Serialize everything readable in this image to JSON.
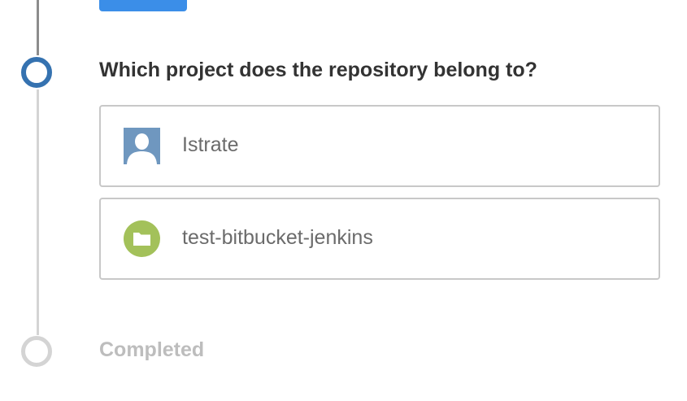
{
  "wizard": {
    "question": "Which project does the repository belong to?",
    "options": [
      {
        "label": "Istrate",
        "icon": "user-avatar-icon"
      },
      {
        "label": "test-bitbucket-jenkins",
        "icon": "folder-icon"
      }
    ],
    "next_step_label": "Completed"
  },
  "colors": {
    "accent": "#3572b0",
    "button": "#3b8ee8",
    "folder_badge": "#a3c15a",
    "avatar_bg": "#6f97bf"
  }
}
